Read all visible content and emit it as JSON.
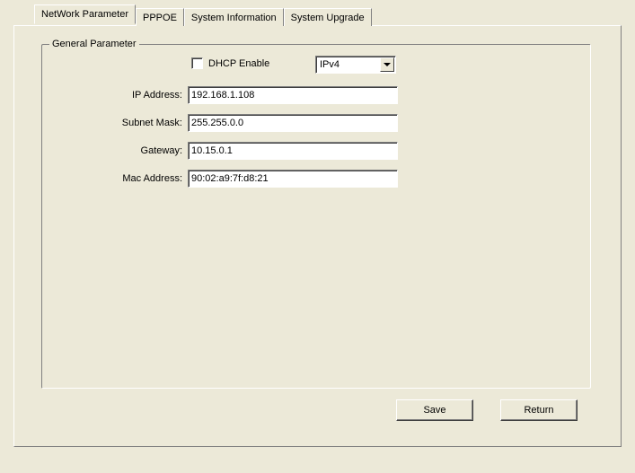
{
  "tabs": {
    "network": "NetWork Parameter",
    "pppoe": "PPPOE",
    "sysinfo": "System Information",
    "sysupgrade": "System Upgrade"
  },
  "fieldset_title": "General Parameter",
  "dhcp_label": "DHCP Enable",
  "ip_version": "IPv4",
  "rows": {
    "ip": {
      "label": "IP Address:",
      "value": "192.168.1.108"
    },
    "mask": {
      "label": "Subnet Mask:",
      "value": "255.255.0.0"
    },
    "gateway": {
      "label": "Gateway:",
      "value": "10.15.0.1"
    },
    "mac": {
      "label": "Mac Address:",
      "value": "90:02:a9:7f:d8:21"
    }
  },
  "buttons": {
    "save": "Save",
    "return": "Return"
  }
}
